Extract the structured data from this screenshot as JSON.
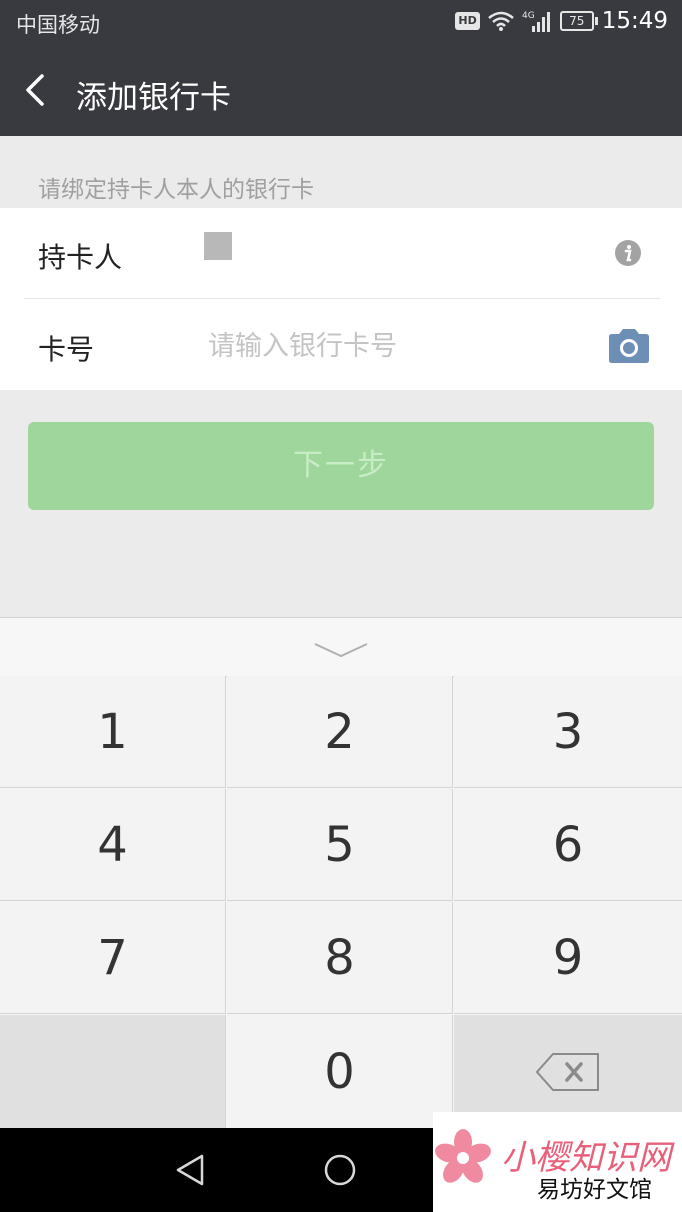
{
  "status_bar": {
    "carrier": "中国移动",
    "hd": "HD",
    "network": "4G",
    "battery": "75",
    "time": "15:49"
  },
  "nav": {
    "title": "添加银行卡"
  },
  "form": {
    "hint": "请绑定持卡人本人的银行卡",
    "holder_label": "持卡人",
    "card_label": "卡号",
    "card_placeholder": "请输入银行卡号"
  },
  "next_button": {
    "label": "下一步"
  },
  "keypad": {
    "keys": [
      "1",
      "2",
      "3",
      "4",
      "5",
      "6",
      "7",
      "8",
      "9",
      "0"
    ]
  },
  "watermark": {
    "title": "小樱知识网",
    "subtitle": "易坊好文馆"
  },
  "colors": {
    "header_bg": "#393a3f",
    "primary_button": "#9ed69b",
    "page_bg": "#ebebeb",
    "camera_icon": "#6d8fb5"
  },
  "icons": [
    "back-arrow-icon",
    "info-icon",
    "camera-icon",
    "chevron-down-icon",
    "backspace-icon",
    "nav-back-icon",
    "nav-home-icon",
    "wifi-icon",
    "signal-icon"
  ]
}
